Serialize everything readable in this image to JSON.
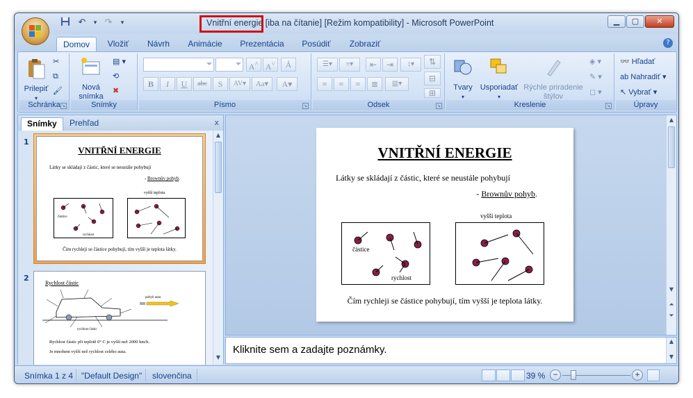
{
  "window": {
    "title_highlight": "Vnitřní energie",
    "title_rest": " [iba na čítanie] [Režim kompatibility] - Microsoft PowerPoint"
  },
  "tabs": [
    "Domov",
    "Vložiť",
    "Návrh",
    "Animácie",
    "Prezentácia",
    "Posúdiť",
    "Zobraziť"
  ],
  "ribbon": {
    "groups": {
      "clipboard": "Schránka",
      "slides": "Snímky",
      "font": "Písmo",
      "paragraph": "Odsek",
      "drawing": "Kreslenie",
      "editing": "Úpravy"
    },
    "paste": "Prilepiť",
    "new_slide_1": "Nová",
    "new_slide_2": "snímka",
    "shapes": "Tvary",
    "arrange": "Usporiadať",
    "quick_styles_1": "Rýchle priradenie",
    "quick_styles_2": "štýlov",
    "find": "Hľadať",
    "replace": "Nahradiť",
    "select": "Vybrať"
  },
  "left_pane": {
    "tab_slides": "Snímky",
    "tab_outline": "Prehľad",
    "close": "x"
  },
  "slide1": {
    "number": "1",
    "title": "VNITŘNÍ ENERGIE",
    "line1": "Látky se skládají  z částic,  které se neustále  pohybují",
    "line2_prefix": "- ",
    "line2_link": "Brownův pohyb",
    "line2_suffix": ".",
    "label_particles": "částice",
    "label_speed": "rychlost",
    "label_higher_temp": "vyšší teplota",
    "footer": "Čím rychleji  se částice  pohybují,  tím vyšší je teplota látky."
  },
  "slide2": {
    "number": "2",
    "title": "Rychlost částic",
    "label_car_speed": "pohyb auta",
    "label_particle_speed": "rychlost částic",
    "line1": "Rychlost částic při teplotě 0° C je vyšší než 2000 km/h.",
    "line2": "Je mnohem vyšší než rychlost celého auta."
  },
  "notes": {
    "placeholder": "Kliknite sem a zadajte poznámky."
  },
  "status": {
    "slide": "Snímka 1 z 4",
    "theme": "\"Default Design\"",
    "language": "slovenčina",
    "zoom": "39 %"
  },
  "colors": {
    "particle": "#8a1f4a",
    "selection": "#f0a24b",
    "title_highlight_box": "#d01010"
  }
}
